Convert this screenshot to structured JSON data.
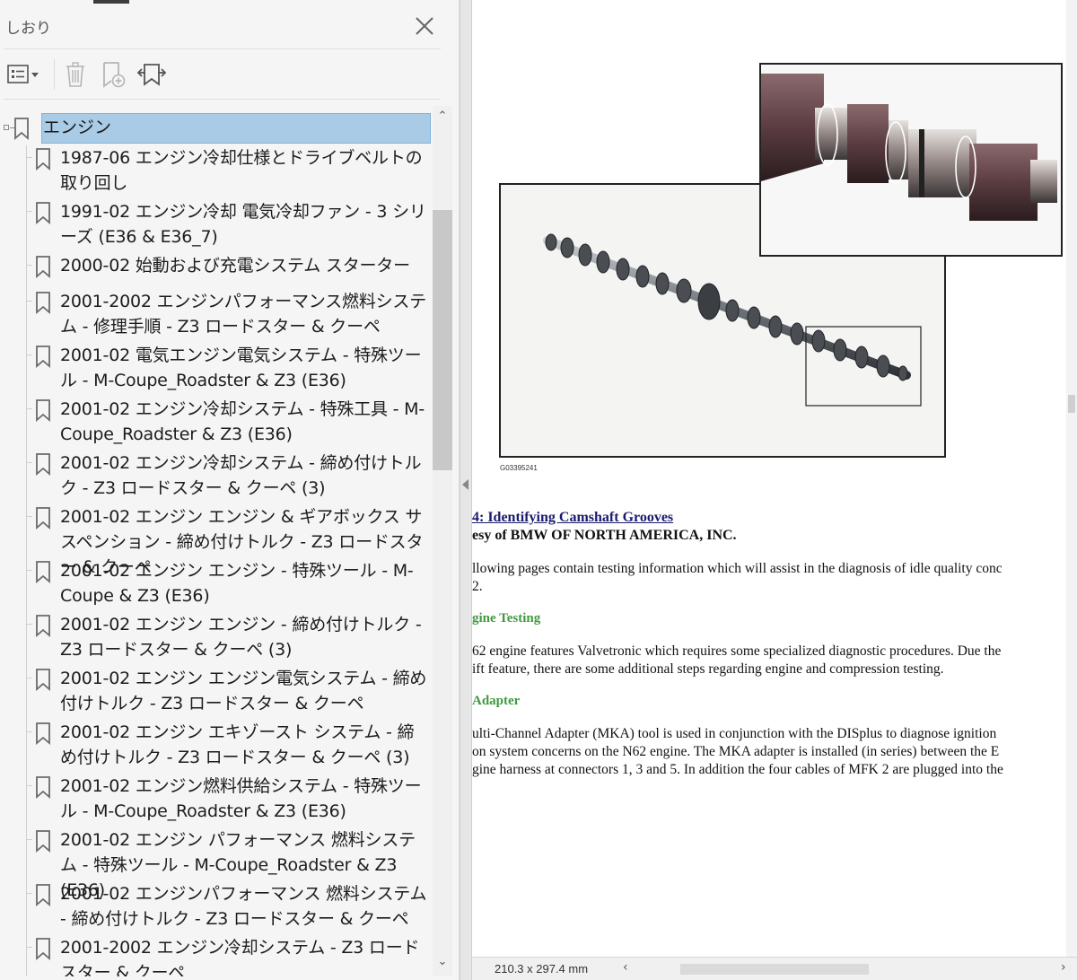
{
  "panel": {
    "title": "しおり",
    "close_icon": "close-icon",
    "toolbar": {
      "options_icon": "bookmark-options-icon",
      "delete_icon": "trash-icon",
      "new_icon": "new-bookmark-icon",
      "expand_icon": "expand-bookmark-icon"
    }
  },
  "tree": {
    "root": {
      "label": "エンジン",
      "icon": "bookmark-icon"
    },
    "items": [
      {
        "label": "1987-06 エンジン冷却仕様とドライブベルトの取り回し"
      },
      {
        "label": "1991-02 エンジン冷却 電気冷却ファン - 3 シリーズ (E36 & E36_7)"
      },
      {
        "label": "2000-02 始動および充電システム スターター"
      },
      {
        "label": "2001-2002 エンジンパフォーマンス燃料システム - 修理手順 - Z3 ロードスター & クーペ"
      },
      {
        "label": "2001-02 電気エンジン電気システム - 特殊ツール - M-Coupe_Roadster & Z3 (E36)"
      },
      {
        "label": "2001-02 エンジン冷却システム - 特殊工具 - M-Coupe_Roadster & Z3 (E36)"
      },
      {
        "label": "2001-02 エンジン冷却システム - 締め付けトルク - Z3 ロードスター & クーペ (3)"
      },
      {
        "label": "2001-02 エンジン エンジン & ギアボックス サスペンション - 締め付けトルク - Z3 ロードスター & クーペ"
      },
      {
        "label": "2001-02 エンジン エンジン - 特殊ツール - M-Coupe & Z3 (E36)"
      },
      {
        "label": "2001-02 エンジン エンジン - 締め付けトルク - Z3 ロードスター & クーペ (3)"
      },
      {
        "label": "2001-02 エンジン エンジン電気システム - 締め付けトルク - Z3 ロードスター & クーペ"
      },
      {
        "label": "2001-02 エンジン エキゾースト システム - 締め付けトルク - Z3 ロードスター & クーペ (3)"
      },
      {
        "label": "2001-02 エンジン燃料供給システム - 特殊ツール - M-Coupe_Roadster & Z3 (E36)"
      },
      {
        "label": "2001-02 エンジン パフォーマンス 燃料システム - 特殊ツール - M-Coupe_Roadster & Z3 (E36)"
      },
      {
        "label": "2001-02 エンジンパフォーマンス 燃料システム - 締め付けトルク - Z3 ロードスター & クーペ"
      },
      {
        "label": "2001-2002 エンジン冷却システム - Z3 ロードスター & クーペ"
      }
    ]
  },
  "document": {
    "figure_id": "G03395241",
    "figure_caption": "4: Identifying Camshaft Grooves",
    "courtesy": "esy of BMW OF NORTH AMERICA, INC.",
    "intro_line1": "llowing pages contain testing information which will assist in the diagnosis of idle quality conc",
    "intro_line2": "2.",
    "heading1": "gine Testing",
    "para1_line1": "62 engine features Valvetronic which requires some specialized diagnostic procedures. Due the",
    "para1_line2": "ift feature, there are some additional steps regarding engine and compression testing.",
    "heading2": "Adapter",
    "para2_line1": "ulti-Channel Adapter (MKA) tool is used in conjunction with the DISplus to diagnose ignition",
    "para2_line2": "on system concerns on the N62 engine. The MKA adapter is installed (in series) between the E",
    "para2_line3": "gine harness at connectors 1, 3 and 5. In addition the four cables of MFK 2 are plugged into the"
  },
  "statusbar": {
    "page_size": "210.3 x 297.4 mm"
  },
  "colors": {
    "selection": "#a9cbe6",
    "link": "#1a1a6e",
    "heading_green": "#3f9a3f"
  }
}
